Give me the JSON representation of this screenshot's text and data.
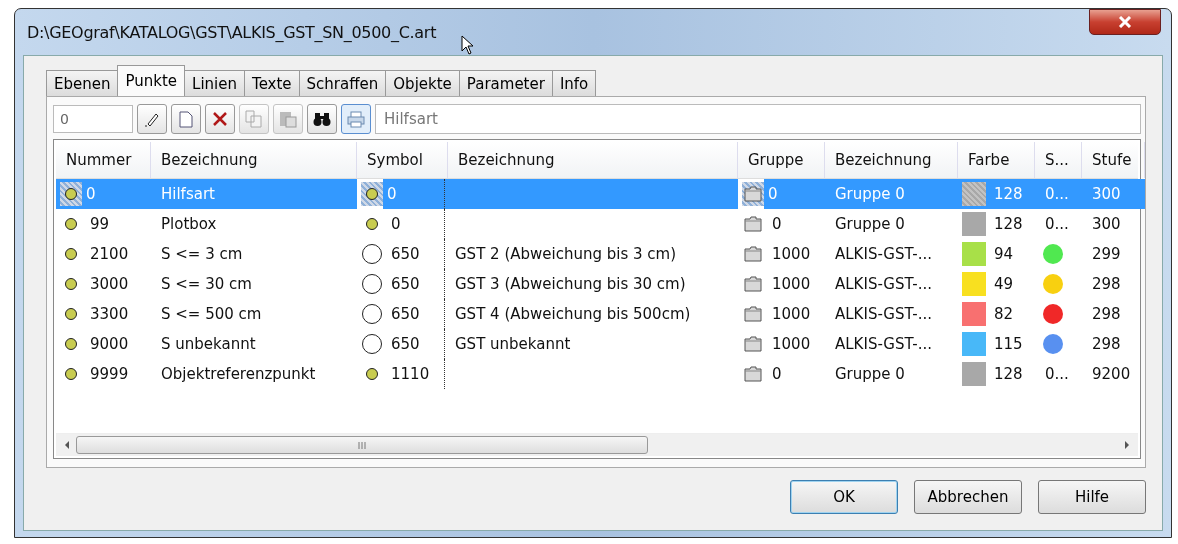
{
  "window": {
    "title": "D:\\GEOgraf\\KATALOG\\GST\\ALKIS_GST_SN_0500_C.art"
  },
  "tabs": [
    {
      "label": "Ebenen",
      "selected": false
    },
    {
      "label": "Punkte",
      "selected": true
    },
    {
      "label": "Linien",
      "selected": false
    },
    {
      "label": "Texte",
      "selected": false
    },
    {
      "label": "Schraffen",
      "selected": false
    },
    {
      "label": "Objekte",
      "selected": false
    },
    {
      "label": "Parameter",
      "selected": false
    },
    {
      "label": "Info",
      "selected": false
    }
  ],
  "toolbar": {
    "number_field": {
      "value": "0"
    },
    "tools": [
      {
        "kind": "edit",
        "disabled": false,
        "active": false
      },
      {
        "kind": "new",
        "disabled": false,
        "active": false
      },
      {
        "kind": "delete",
        "disabled": false,
        "active": false
      },
      {
        "kind": "copy",
        "disabled": true,
        "active": false
      },
      {
        "kind": "paste",
        "disabled": true,
        "active": false
      },
      {
        "kind": "find",
        "disabled": false,
        "active": false
      },
      {
        "kind": "print",
        "disabled": false,
        "active": true
      }
    ],
    "name_field": {
      "value": "Hilfsart"
    }
  },
  "table": {
    "columns": [
      "Nummer",
      "Bezeichnung",
      "Symbol",
      "Bezeichnung",
      "Gruppe",
      "Bezeichnung",
      "Farbe",
      "S...",
      "Stufe"
    ],
    "rows": [
      {
        "selected": true,
        "nummer": "0",
        "bezeichnung": "Hilfsart",
        "symbol": {
          "kind": "dot",
          "number": "0"
        },
        "symbol_bezeichnung": "",
        "gruppe": "0",
        "gruppe_bezeichnung": "Gruppe 0",
        "farbe": {
          "color": "#a8a8a8",
          "number": "128"
        },
        "s": {
          "kind": "text",
          "text": "0..."
        },
        "stufe": "300"
      },
      {
        "selected": false,
        "nummer": "99",
        "bezeichnung": "Plotbox",
        "symbol": {
          "kind": "dot",
          "number": "0"
        },
        "symbol_bezeichnung": "",
        "gruppe": "0",
        "gruppe_bezeichnung": "Gruppe 0",
        "farbe": {
          "color": "#a8a8a8",
          "number": "128"
        },
        "s": {
          "kind": "text",
          "text": "0..."
        },
        "stufe": "300"
      },
      {
        "selected": false,
        "nummer": "2100",
        "bezeichnung": "S <= 3 cm",
        "symbol": {
          "kind": "circle",
          "number": "650"
        },
        "symbol_bezeichnung": "GST 2 (Abweichung bis 3 cm)",
        "gruppe": "1000",
        "gruppe_bezeichnung": "ALKIS-GST-...",
        "farbe": {
          "color": "#a8e048",
          "number": "94"
        },
        "s": {
          "kind": "dot",
          "color": "#50e850"
        },
        "stufe": "299"
      },
      {
        "selected": false,
        "nummer": "3000",
        "bezeichnung": "S <= 30 cm",
        "symbol": {
          "kind": "circle",
          "number": "650"
        },
        "symbol_bezeichnung": "GST 3 (Abweichung bis 30 cm)",
        "gruppe": "1000",
        "gruppe_bezeichnung": "ALKIS-GST-...",
        "farbe": {
          "color": "#f8e020",
          "number": "49"
        },
        "s": {
          "kind": "dot",
          "color": "#f8d010"
        },
        "stufe": "298"
      },
      {
        "selected": false,
        "nummer": "3300",
        "bezeichnung": "S <= 500 cm",
        "symbol": {
          "kind": "circle",
          "number": "650"
        },
        "symbol_bezeichnung": "GST 4 (Abweichung bis 500cm)",
        "gruppe": "1000",
        "gruppe_bezeichnung": "ALKIS-GST-...",
        "farbe": {
          "color": "#f87070",
          "number": "82"
        },
        "s": {
          "kind": "dot",
          "color": "#f02828"
        },
        "stufe": "298"
      },
      {
        "selected": false,
        "nummer": "9000",
        "bezeichnung": "S unbekannt",
        "symbol": {
          "kind": "circle",
          "number": "650"
        },
        "symbol_bezeichnung": "GST unbekannt",
        "gruppe": "1000",
        "gruppe_bezeichnung": "ALKIS-GST-...",
        "farbe": {
          "color": "#48b8f8",
          "number": "115"
        },
        "s": {
          "kind": "dot",
          "color": "#5890f0"
        },
        "stufe": "298"
      },
      {
        "selected": false,
        "nummer": "9999",
        "bezeichnung": "Objektreferenzpunkt",
        "symbol": {
          "kind": "dot",
          "number": "1110"
        },
        "symbol_bezeichnung": "",
        "gruppe": "0",
        "gruppe_bezeichnung": "Gruppe 0",
        "farbe": {
          "color": "#a8a8a8",
          "number": "128"
        },
        "s": {
          "kind": "text",
          "text": "0..."
        },
        "stufe": "9200"
      }
    ]
  },
  "buttons": [
    {
      "label": "OK",
      "default": true
    },
    {
      "label": "Abbrechen",
      "default": false
    },
    {
      "label": "Hilfe",
      "default": false
    }
  ]
}
